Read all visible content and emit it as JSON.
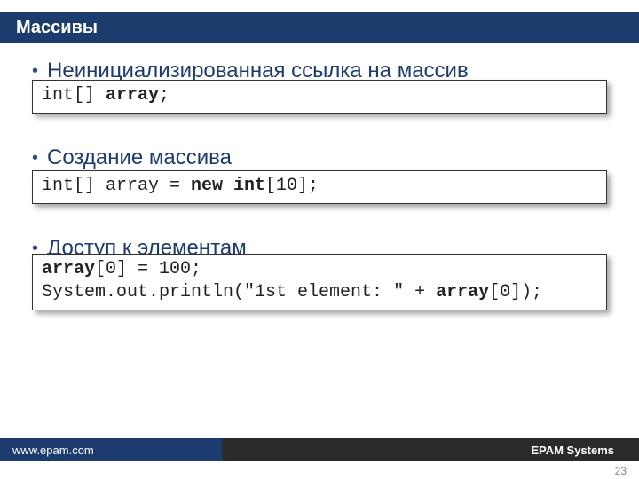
{
  "title": "Массивы",
  "sections": [
    {
      "heading": "Неинициализированная ссылка на массив",
      "code_plain": "int[] ",
      "code_bold": "array",
      "code_tail": ";"
    },
    {
      "heading": "Создание массива",
      "code_plain": "int[] array = ",
      "code_bold": "new int",
      "code_tail": "[10];"
    },
    {
      "heading": "Доступ к элементам",
      "code_lines": [
        {
          "pre": "",
          "bold": "array",
          "mid": "[0] = 100;",
          "post": ""
        },
        {
          "pre": "System.out.println(\"1st element: \" + ",
          "bold": "array",
          "mid": "[0]);",
          "post": ""
        }
      ]
    }
  ],
  "footer": {
    "left": "www.epam.com",
    "right": "EPAM Systems"
  },
  "page_number": "23"
}
